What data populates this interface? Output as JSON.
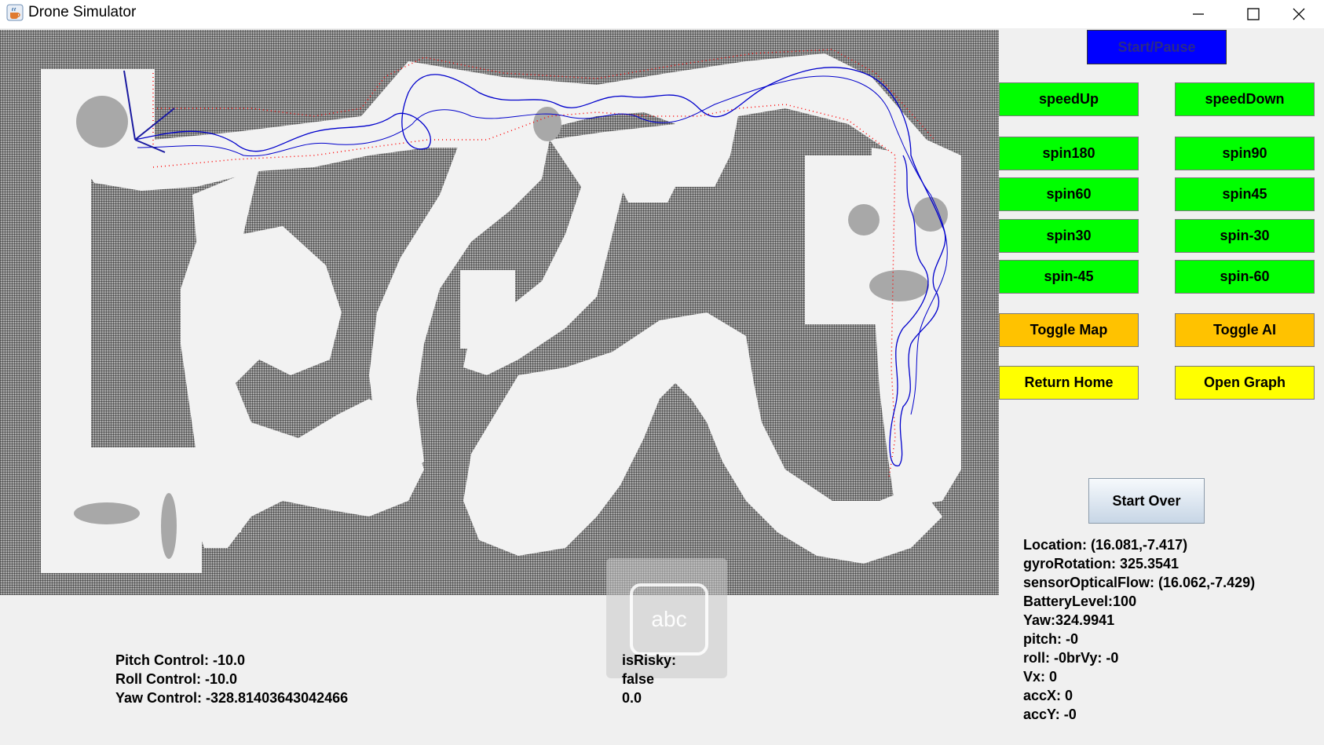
{
  "window": {
    "title": "Drone Simulator"
  },
  "colors": {
    "green": "#00ff00",
    "orange": "#ffc200",
    "yellow": "#ffff00",
    "blue": "#0000ff",
    "path": "#0000cc",
    "wall_hits": "#ff0000"
  },
  "controls": {
    "start_pause": "Start/Pause",
    "speed_up": "speedUp",
    "speed_down": "speedDown",
    "spin180": "spin180",
    "spin90": "spin90",
    "spin60": "spin60",
    "spin45": "spin45",
    "spin30": "spin30",
    "spin_neg30": "spin-30",
    "spin_neg45": "spin-45",
    "spin_neg60": "spin-60",
    "toggle_map": "Toggle Map",
    "toggle_ai": "Toggle AI",
    "return_home": "Return Home",
    "open_graph": "Open Graph",
    "start_over": "Start Over"
  },
  "sensors": {
    "location": "Location: (16.081,-7.417)",
    "gyro": "gyroRotation: 325.3541",
    "optical_flow": "sensorOpticalFlow: (16.062,-7.429)",
    "battery": "BatteryLevel:100",
    "yaw": "Yaw:324.9941",
    "pitch": "pitch: -0",
    "roll": "roll: -0brVy: -0",
    "vx": "Vx: 0",
    "accx": "accX: 0",
    "accy": "accY: -0"
  },
  "control_values": {
    "pitch": "Pitch Control: -10.0",
    "roll": "Roll Control: -10.0",
    "yaw": "Yaw Control: -328.81403643042466"
  },
  "risk": {
    "label": "isRisky:",
    "value": "false",
    "number": "0.0"
  },
  "keyboard_overlay": {
    "text": "abc"
  }
}
